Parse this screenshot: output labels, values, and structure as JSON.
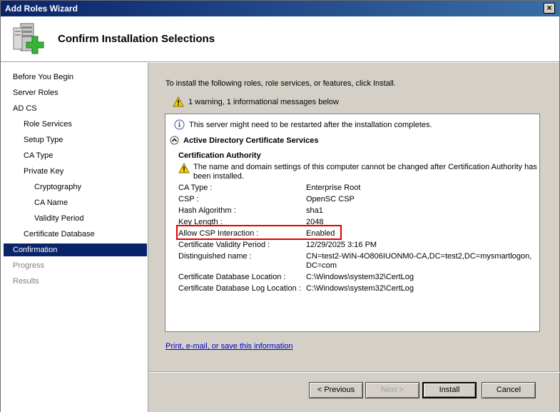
{
  "window": {
    "title": "Add Roles Wizard",
    "close_label": "×"
  },
  "header": {
    "title": "Confirm Installation Selections"
  },
  "nav": [
    {
      "label": "Before You Begin",
      "indent": 0,
      "state": "normal"
    },
    {
      "label": "Server Roles",
      "indent": 0,
      "state": "normal"
    },
    {
      "label": "AD CS",
      "indent": 0,
      "state": "normal"
    },
    {
      "label": "Role Services",
      "indent": 1,
      "state": "normal"
    },
    {
      "label": "Setup Type",
      "indent": 1,
      "state": "normal"
    },
    {
      "label": "CA Type",
      "indent": 1,
      "state": "normal"
    },
    {
      "label": "Private Key",
      "indent": 1,
      "state": "normal"
    },
    {
      "label": "Cryptography",
      "indent": 2,
      "state": "normal"
    },
    {
      "label": "CA Name",
      "indent": 2,
      "state": "normal"
    },
    {
      "label": "Validity Period",
      "indent": 2,
      "state": "normal"
    },
    {
      "label": "Certificate Database",
      "indent": 1,
      "state": "normal"
    },
    {
      "label": "Confirmation",
      "indent": 0,
      "state": "selected"
    },
    {
      "label": "Progress",
      "indent": 0,
      "state": "disabled"
    },
    {
      "label": "Results",
      "indent": 0,
      "state": "disabled"
    }
  ],
  "main": {
    "intro": "To install the following roles, role services, or features, click Install.",
    "warning_summary": "1 warning, 1 informational messages below",
    "info_message": "This server might need to be restarted after the installation completes.",
    "section_title": "Active Directory Certificate Services",
    "subsection_title": "Certification Authority",
    "ca_warning_line1": "The name and domain settings of this computer cannot be changed after Certification Authority has",
    "ca_warning_line2": "been installed.",
    "properties": [
      {
        "label": "CA Type :",
        "value": "Enterprise Root"
      },
      {
        "label": "CSP :",
        "value": "OpenSC CSP"
      },
      {
        "label": "Hash Algorithm :",
        "value": "sha1"
      },
      {
        "label": "Key Length :",
        "value": "2048"
      },
      {
        "label": "Allow CSP Interaction :",
        "value": "Enabled"
      },
      {
        "label": "Certificate Validity Period :",
        "value": "12/29/2025 3:16 PM"
      },
      {
        "label": "Distinguished name :",
        "value": "CN=test2-WIN-4O806IUONM0-CA,DC=test2,DC=mysmartlogon,",
        "value2": "DC=com"
      },
      {
        "label": "Certificate Database Location :",
        "value": "C:\\Windows\\system32\\CertLog"
      },
      {
        "label": "Certificate Database Log Location :",
        "value": "C:\\Windows\\system32\\CertLog"
      }
    ],
    "link": "Print, e-mail, or save this information"
  },
  "buttons": {
    "previous": "< Previous",
    "next": "Next >",
    "install": "Install",
    "cancel": "Cancel"
  },
  "icons": {
    "header": "server-add-icon",
    "warning": "warning-icon",
    "info": "info-icon",
    "collapse": "collapse-icon"
  },
  "colors": {
    "selection": "#0a246a",
    "highlight_box": "#e00000",
    "link": "#0000cc"
  }
}
